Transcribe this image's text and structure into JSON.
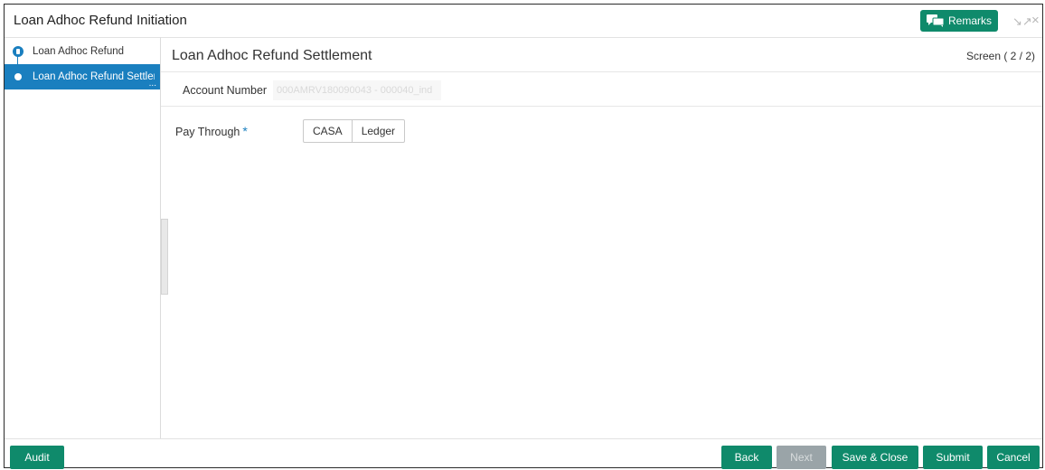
{
  "window": {
    "title": "Loan Adhoc Refund Initiation",
    "remarks_label": "Remarks",
    "minimize_icon": "↘↗",
    "close_icon": "×"
  },
  "sidebar": {
    "steps": [
      {
        "label": "Loan Adhoc Refund",
        "state": "completed"
      },
      {
        "label": "Loan Adhoc Refund Settlem",
        "state": "active"
      }
    ],
    "overflow_glyph": "..."
  },
  "main": {
    "section_title": "Loan Adhoc Refund Settlement",
    "screen_indicator": "Screen ( 2 / 2)",
    "account_number_label": "Account Number",
    "account_number_value": "000AMRV180090043 - 000040_ind",
    "pay_through_label": "Pay Through",
    "required_marker": "*",
    "pay_through_options": [
      "CASA",
      "Ledger"
    ]
  },
  "footer": {
    "audit": "Audit",
    "back": "Back",
    "next": "Next",
    "save_close": "Save & Close",
    "submit": "Submit",
    "cancel": "Cancel"
  },
  "colors": {
    "accent_green": "#0f8a6b",
    "accent_blue": "#1a7fbf",
    "disabled_gray": "#9aa4a8"
  }
}
